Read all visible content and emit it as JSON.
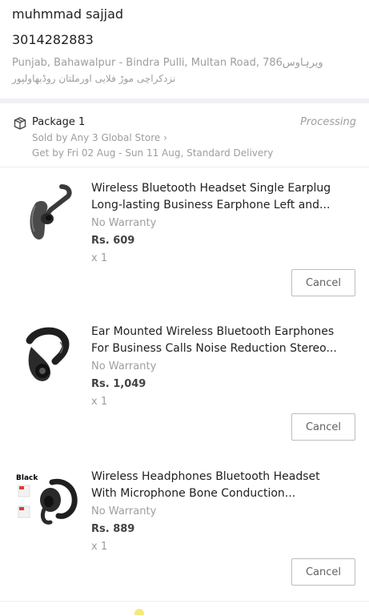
{
  "address": {
    "name": "muhmmad sajjad",
    "phone": "3014282883",
    "line1": "Punjab,  Bahawalpur - Bindra Pulli,  Multan Road, 786ویرہاوس",
    "line2": "نزدکراچی موڑ فلایی اورملتان روڈبھاولپور"
  },
  "package": {
    "title": "Package 1",
    "status": "Processing",
    "seller": "Sold by Any 3 Global Store",
    "seller_chevron": "›",
    "delivery": "Get by Fri 02 Aug - Sun 11 Aug, Standard Delivery",
    "icon": "package-box-icon"
  },
  "items": [
    {
      "title_line1": "Wireless Bluetooth Headset Single Earplug",
      "title_line2": "Long-lasting Business Earphone Left and...",
      "warranty": "No Warranty",
      "price": "Rs. 609",
      "qty": "x 1",
      "cancel": "Cancel"
    },
    {
      "title_line1": "Ear Mounted Wireless Bluetooth Earphones",
      "title_line2": "For Business Calls Noise Reduction Stereo...",
      "warranty": "No Warranty",
      "price": "Rs. 1,049",
      "qty": "x 1",
      "cancel": "Cancel"
    },
    {
      "title_line1": "Wireless Headphones Bluetooth Headset",
      "title_line2": "With Microphone Bone Conduction...",
      "warranty": "No Warranty",
      "price": "Rs. 889",
      "qty": "x 1",
      "cancel": "Cancel",
      "thumb_label": "Black"
    }
  ],
  "colors": {
    "text_primary": "#212121",
    "text_secondary": "#9e9e9e",
    "divider": "#eff0f5"
  }
}
